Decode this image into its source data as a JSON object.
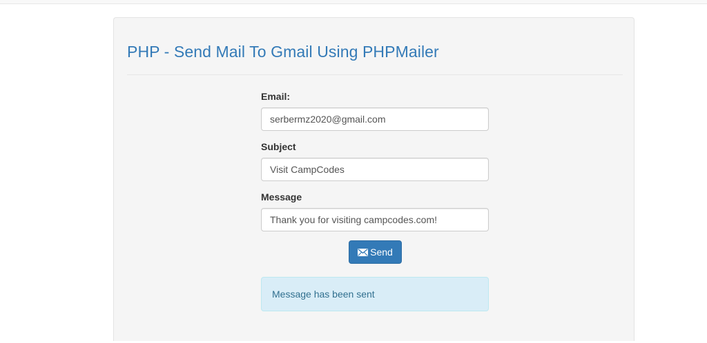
{
  "page": {
    "title": "PHP - Send Mail To Gmail Using PHPMailer"
  },
  "form": {
    "email": {
      "label": "Email:",
      "value": "serbermz2020@gmail.com"
    },
    "subject": {
      "label": "Subject",
      "value": "Visit CampCodes"
    },
    "message": {
      "label": "Message",
      "value": "Thank you for visiting campcodes.com!"
    },
    "send_button": {
      "label": "Send",
      "icon": "envelope-icon"
    }
  },
  "alert": {
    "text": "Message has been sent",
    "type": "info"
  },
  "colors": {
    "primary": "#337ab7",
    "well_background": "#f5f5f5",
    "alert_background": "#d9edf7",
    "alert_text": "#31708f"
  }
}
